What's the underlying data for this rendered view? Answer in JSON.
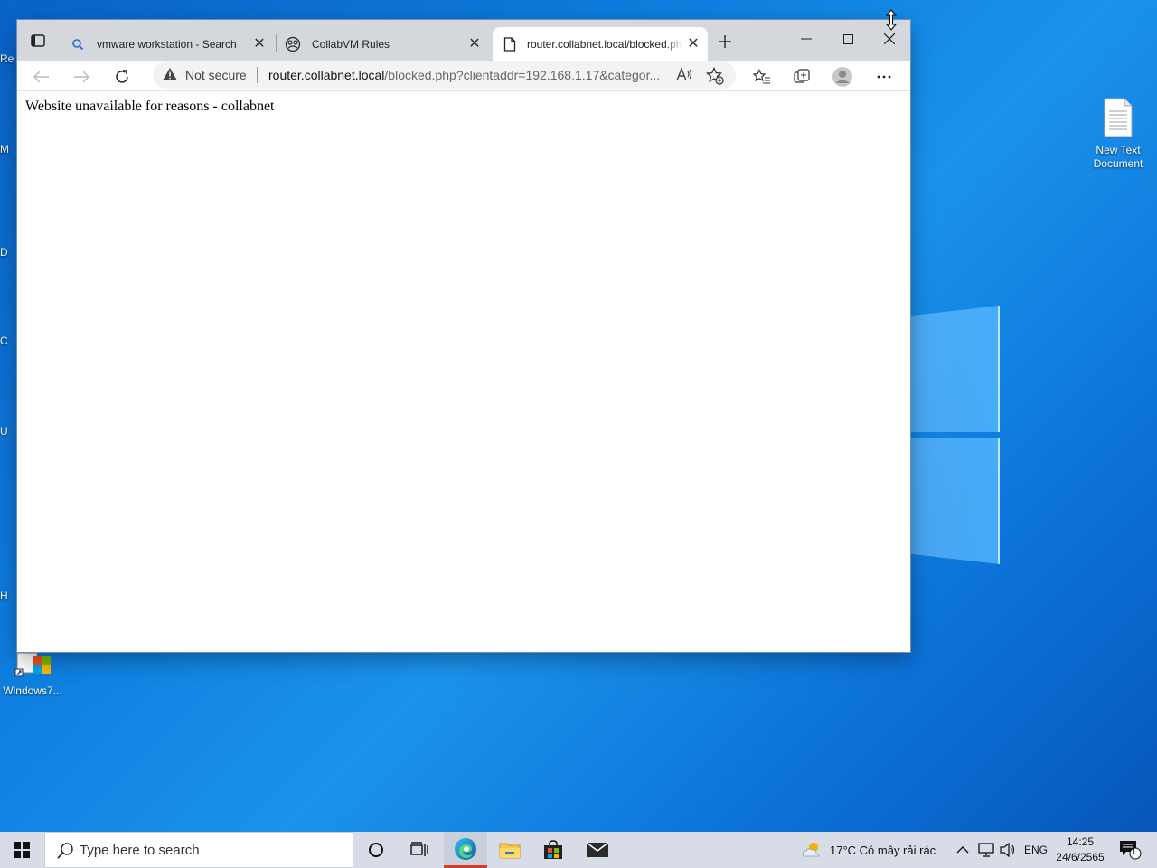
{
  "desktop": {
    "icons": [
      {
        "label": "New Text Document"
      },
      {
        "label": "Windows7..."
      }
    ],
    "left_fragments": [
      "Re",
      "M",
      "D",
      "C",
      "U",
      "H"
    ]
  },
  "browser": {
    "tabs": [
      {
        "title": "vmware workstation - Search"
      },
      {
        "title": "CollabVM Rules"
      },
      {
        "title": "router.collabnet.local/blocked.php"
      }
    ],
    "address": {
      "security_label": "Not secure",
      "url_host": "router.collabnet.local",
      "url_path": "/blocked.php?clientaddr=192.168.1.17&categor..."
    },
    "page": {
      "message": "Website unavailable for reasons - collabnet"
    }
  },
  "taskbar": {
    "search_placeholder": "Type here to search",
    "weather": "17°C  Có mây rải rác",
    "language": "ENG",
    "time": "14:25",
    "date": "24/6/2565",
    "notification_count": "1"
  }
}
